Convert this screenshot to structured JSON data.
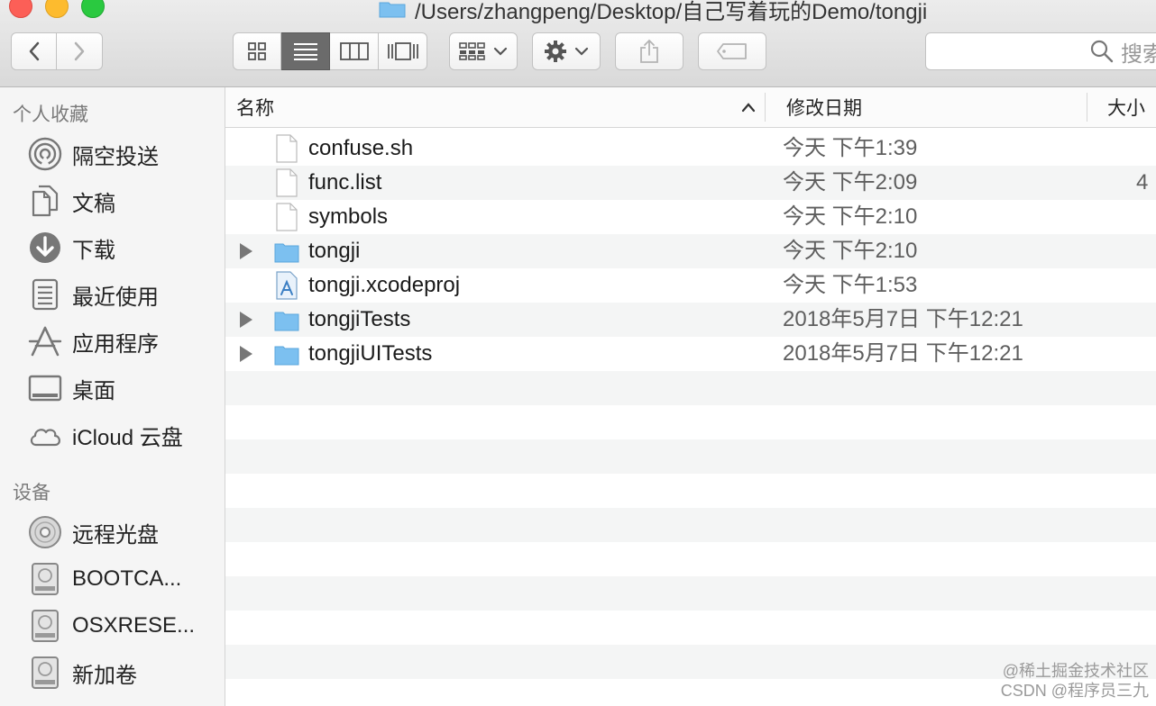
{
  "window": {
    "path": "/Users/zhangpeng/Desktop/自己写着玩的Demo/tongji"
  },
  "toolbar": {
    "back_icon": "chevron-left-icon",
    "forward_icon": "chevron-right-icon",
    "view_modes": [
      "icon-view",
      "list-view",
      "column-view",
      "cover-flow-view"
    ],
    "active_view": "list-view",
    "search_placeholder": "搜索"
  },
  "sidebar": {
    "favorites_title": "个人收藏",
    "favorites": [
      {
        "label": "隔空投送",
        "icon": "airdrop-icon"
      },
      {
        "label": "文稿",
        "icon": "documents-icon"
      },
      {
        "label": "下载",
        "icon": "downloads-icon"
      },
      {
        "label": "最近使用",
        "icon": "recents-icon"
      },
      {
        "label": "应用程序",
        "icon": "applications-icon"
      },
      {
        "label": "桌面",
        "icon": "desktop-icon"
      },
      {
        "label": "iCloud 云盘",
        "icon": "icloud-icon"
      }
    ],
    "devices_title": "设备",
    "devices": [
      {
        "label": "远程光盘",
        "icon": "optical-disc-icon"
      },
      {
        "label": "BOOTCA...",
        "icon": "hard-drive-icon"
      },
      {
        "label": "OSXRESE...",
        "icon": "hard-drive-icon"
      },
      {
        "label": "新加卷",
        "icon": "hard-drive-icon"
      }
    ]
  },
  "columns": {
    "name": "名称",
    "date": "修改日期",
    "size": "大小"
  },
  "files": [
    {
      "name": "confuse.sh",
      "date": "今天 下午1:39",
      "size": "",
      "type": "file",
      "expandable": false
    },
    {
      "name": "func.list",
      "date": "今天 下午2:09",
      "size": "4",
      "type": "file",
      "expandable": false
    },
    {
      "name": "symbols",
      "date": "今天 下午2:10",
      "size": "",
      "type": "file",
      "expandable": false
    },
    {
      "name": "tongji",
      "date": "今天 下午2:10",
      "size": "",
      "type": "folder",
      "expandable": true
    },
    {
      "name": "tongji.xcodeproj",
      "date": "今天 下午1:53",
      "size": "",
      "type": "xcodeproj",
      "expandable": false
    },
    {
      "name": "tongjiTests",
      "date": "2018年5月7日 下午12:21",
      "size": "",
      "type": "folder",
      "expandable": true
    },
    {
      "name": "tongjiUITests",
      "date": "2018年5月7日 下午12:21",
      "size": "",
      "type": "folder",
      "expandable": true
    }
  ],
  "watermark": {
    "line1": "@稀土掘金技术社区",
    "line2": "CSDN @程序员三九"
  },
  "colors": {
    "folder": "#7cc0f0",
    "active_segment": "#6b6b6b",
    "row_alt": "#f4f5f5"
  }
}
